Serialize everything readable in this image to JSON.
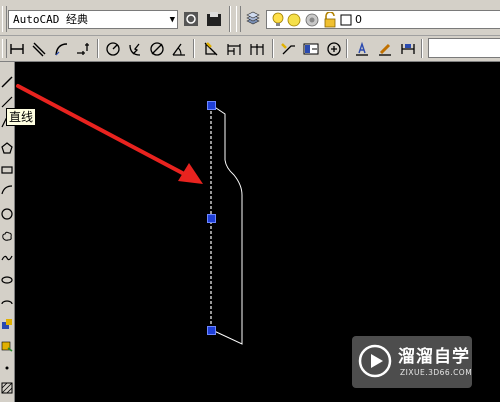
{
  "workspace": {
    "label": "AutoCAD 经典"
  },
  "layer": {
    "current": "0"
  },
  "tooltip": {
    "text": "直线"
  },
  "watermark": {
    "name": "溜溜自学",
    "url": "ZIXUE.3D66.COM"
  },
  "colors": {
    "canvas": "#000000",
    "toolbar": "#d4d0c8",
    "arrow": "#e8231f",
    "grip": "#1f3fd6",
    "geometry": "#ffffff"
  },
  "toolbar_top_icons": [
    "workspace-settings-icon",
    "workspace-save-icon",
    "layer-manager-icon",
    "layer-on-icon",
    "layer-freeze-icon",
    "layer-color-icon",
    "layer-lock-icon"
  ],
  "toolbar_dim_icons": [
    "linear-dim-icon",
    "aligned-dim-icon",
    "arc-length-dim-icon",
    "ordinate-dim-icon",
    "radius-dim-icon",
    "jogged-dim-icon",
    "diameter-dim-icon",
    "angular-dim-icon",
    "quick-dim-icon",
    "baseline-dim-icon",
    "continue-dim-icon",
    "quick-leader-icon",
    "tolerance-icon",
    "center-mark-icon",
    "dimedit-icon",
    "dimtedit-icon",
    "dim-update-icon"
  ],
  "left_tools": [
    "line-icon",
    "construction-line-icon",
    "polyline-icon",
    "polygon-icon",
    "rectangle-icon",
    "arc-icon",
    "circle-icon",
    "revcloud-icon",
    "spline-icon",
    "ellipse-icon",
    "ellipse-arc-icon",
    "insert-block-icon",
    "make-block-icon",
    "point-icon",
    "hatch-icon"
  ]
}
